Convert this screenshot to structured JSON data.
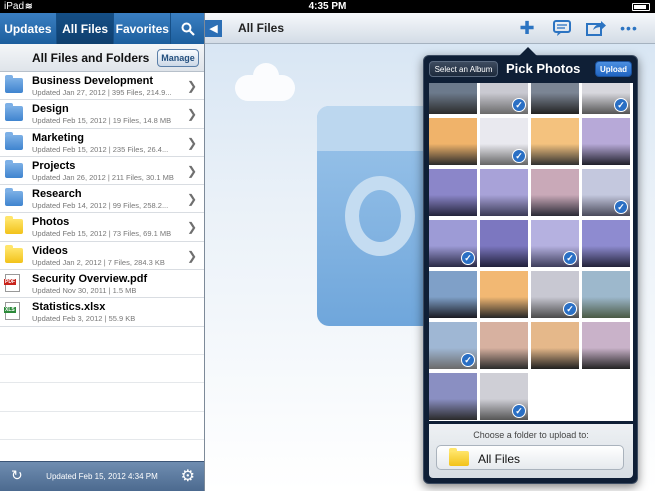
{
  "status_bar": {
    "carrier": "iPad",
    "time": "4:35 PM"
  },
  "sidebar": {
    "tabs": [
      {
        "label": "Updates"
      },
      {
        "label": "All Files"
      },
      {
        "label": "Favorites"
      }
    ],
    "header_title": "All Files and Folders",
    "manage_label": "Manage",
    "items": [
      {
        "name": "Business Development",
        "meta": "Updated Jan 27, 2012 | 395 Files, 214.9...",
        "kind": "folder-blue"
      },
      {
        "name": "Design",
        "meta": "Updated Feb 15, 2012 | 19 Files, 14.8 MB",
        "kind": "folder-blue"
      },
      {
        "name": "Marketing",
        "meta": "Updated Feb 15, 2012 | 235 Files, 26.4...",
        "kind": "folder-blue"
      },
      {
        "name": "Projects",
        "meta": "Updated Jan 26, 2012 | 211 Files, 30.1 MB",
        "kind": "folder-blue"
      },
      {
        "name": "Research",
        "meta": "Updated Feb 14, 2012 | 99 Files, 258.2...",
        "kind": "folder-blue"
      },
      {
        "name": "Photos",
        "meta": "Updated Feb 15, 2012 | 73 Files, 69.1 MB",
        "kind": "folder-yellow"
      },
      {
        "name": "Videos",
        "meta": "Updated Jan 2, 2012 | 7 Files, 284.3 KB",
        "kind": "folder-yellow"
      },
      {
        "name": "Security Overview.pdf",
        "meta": "Updated Nov 30, 2011 | 1.5 MB",
        "kind": "pdf"
      },
      {
        "name": "Statistics.xlsx",
        "meta": "Updated Feb 3, 2012 | 55.9 KB",
        "kind": "xls"
      }
    ],
    "footer_updated": "Updated Feb 15, 2012 4:34 PM"
  },
  "main": {
    "title": "All Files"
  },
  "popover": {
    "album_button": "Select an Album",
    "title": "Pick Photos",
    "upload_button": "Upload",
    "photos_selected": [
      false,
      true,
      false,
      true,
      false,
      true,
      false,
      false,
      false,
      false,
      false,
      true,
      true,
      false,
      true,
      false,
      false,
      false,
      true,
      false,
      true,
      false,
      false,
      false,
      false,
      true
    ],
    "folder_prompt": "Choose a folder to upload to:",
    "folder_name": "All Files"
  },
  "colors": {
    "accent": "#2c6fb5",
    "tab_bar": "#1c5e9d",
    "popover_bg": "#0f1f36",
    "check": "#2a6fc4"
  }
}
